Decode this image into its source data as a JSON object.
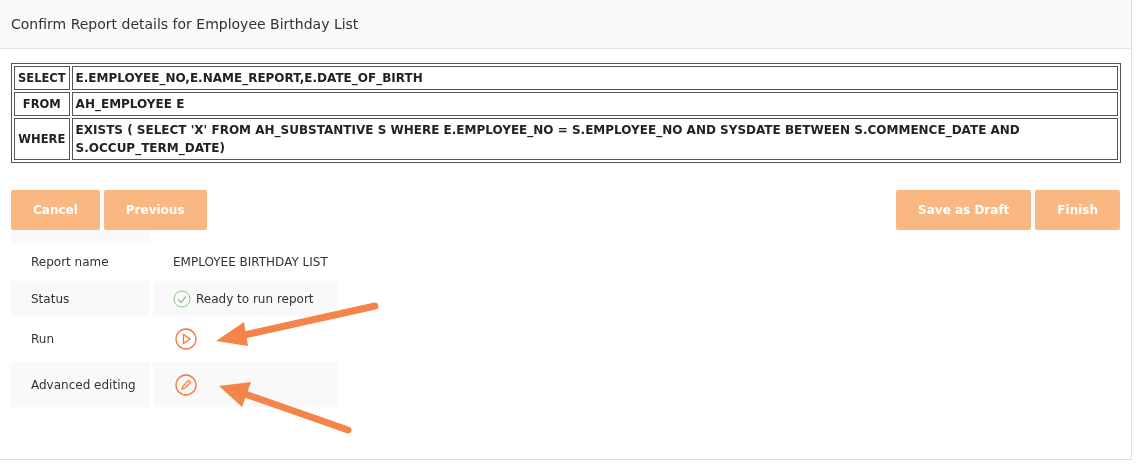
{
  "panel": {
    "title": "Confirm Report details for Employee Birthday List"
  },
  "query": [
    {
      "clause": "SELECT",
      "text": "E.EMPLOYEE_NO,E.NAME_REPORT,E.DATE_OF_BIRTH"
    },
    {
      "clause": "FROM",
      "text": "AH_EMPLOYEE E"
    },
    {
      "clause": "WHERE",
      "text": "EXISTS ( SELECT 'X' FROM AH_SUBSTANTIVE S WHERE E.EMPLOYEE_NO = S.EMPLOYEE_NO AND SYSDATE BETWEEN S.COMMENCE_DATE AND S.OCCUP_TERM_DATE)"
    }
  ],
  "buttons_left": [
    {
      "label": "Cancel",
      "disabled": true
    },
    {
      "label": "Previous",
      "disabled": true
    }
  ],
  "buttons_right": [
    {
      "label": "Save as Draft",
      "disabled": true
    },
    {
      "label": "Finish",
      "disabled": true
    }
  ],
  "details": [
    {
      "kind": "text",
      "label": "Report name",
      "value": "EMPLOYEE BIRTHDAY LIST"
    },
    {
      "kind": "status",
      "label": "Status",
      "value": "Ready to run report"
    },
    {
      "kind": "run",
      "label": "Run"
    },
    {
      "kind": "edit",
      "label": "Advanced editing"
    }
  ]
}
